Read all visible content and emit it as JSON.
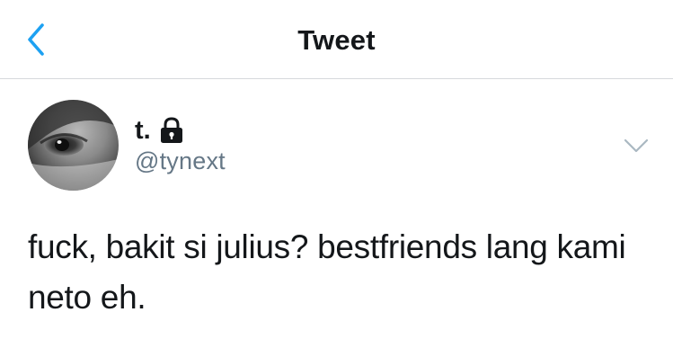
{
  "header": {
    "title": "Tweet",
    "back_icon": "chevron-left-icon",
    "accent_color": "#1da1f2"
  },
  "tweet": {
    "author": {
      "display_name": "t.",
      "handle": "@tynext",
      "protected": true,
      "badge_icon": "lock-icon",
      "avatar": "grayscale-eye-photo"
    },
    "menu_icon": "chevron-down-icon",
    "text": "fuck, bakit si julius? bestfriends lang kami neto eh."
  },
  "colors": {
    "text_primary": "#14171a",
    "text_secondary": "#657786",
    "divider": "#d6d9dc"
  }
}
